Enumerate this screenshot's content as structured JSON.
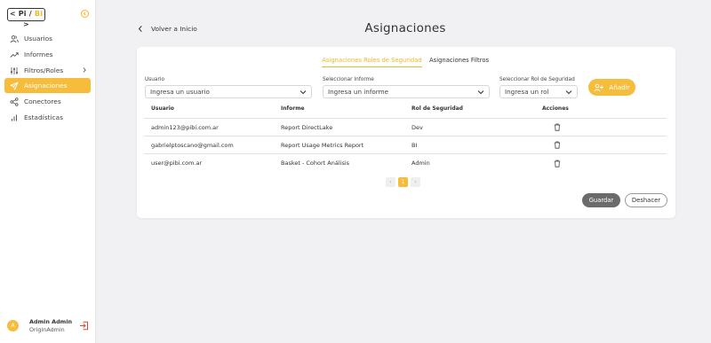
{
  "sidebar": {
    "logo": {
      "left": "< Pi",
      "sep": "/",
      "right": "Bi",
      "end": ">"
    },
    "items": [
      {
        "label": "Usuarios",
        "icon": "users-icon"
      },
      {
        "label": "Informes",
        "icon": "trend-icon"
      },
      {
        "label": "Filtros/Roles",
        "icon": "sliders-icon"
      },
      {
        "label": "Asignaciones",
        "icon": "send-icon",
        "active": true
      },
      {
        "label": "Conectores",
        "icon": "share-icon"
      },
      {
        "label": "Estadísticas",
        "icon": "bar-chart-icon"
      }
    ],
    "user": {
      "initial": "A",
      "name": "Admin Admin",
      "role": "OriginAdmin"
    }
  },
  "header": {
    "back_label": "Volver a Inicio",
    "title": "Asignaciones"
  },
  "tabs": [
    {
      "label": "Asignaciones Roles de Seguridad",
      "active": true
    },
    {
      "label": "Asignaciones Filtros",
      "active": false
    }
  ],
  "form": {
    "usuario_label": "Usuario",
    "usuario_placeholder": "Ingresa un usuario",
    "informe_label": "Seleccionar Informe",
    "informe_placeholder": "Ingresa un informe",
    "rol_label": "Seleccionar Rol de Seguridad",
    "rol_placeholder": "Ingresa un rol",
    "add_label": "Añadir"
  },
  "table": {
    "headers": [
      "Usuario",
      "Informe",
      "Rol de Seguridad",
      "Acciones"
    ],
    "rows": [
      {
        "usuario": "admin123@pibi.com.ar",
        "informe": "Report DirectLake",
        "rol": "Dev"
      },
      {
        "usuario": "gabrielptoscano@gmail.com",
        "informe": "Report Usage Metrics Report",
        "rol": "BI"
      },
      {
        "usuario": "user@pibi.com.ar",
        "informe": "Basket - Cohort Análisis",
        "rol": "Admin"
      }
    ]
  },
  "pagination": {
    "prev": "‹",
    "current": "1",
    "next": "›"
  },
  "actions": {
    "save_label": "Guardar",
    "undo_label": "Deshacer"
  },
  "colors": {
    "accent": "#f6bd3d",
    "accent_text": "#f2b724",
    "save_bg": "#6b6b6b"
  }
}
